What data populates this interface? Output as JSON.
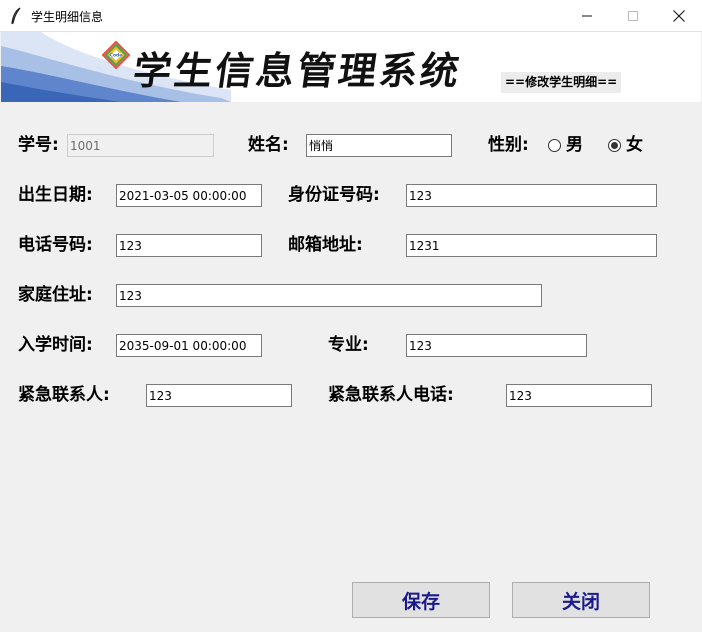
{
  "window": {
    "title": "学生明细信息"
  },
  "banner": {
    "system_title": "学生信息管理系统",
    "mode_label": "==修改学生明细=="
  },
  "form": {
    "student_id": {
      "label": "学号:",
      "value": "1001"
    },
    "name": {
      "label": "姓名:",
      "value": "悄悄"
    },
    "gender": {
      "label": "性别:",
      "options": [
        "男",
        "女"
      ],
      "selected": "女"
    },
    "birth_date": {
      "label": "出生日期:",
      "value": "2021-03-05 00:00:00"
    },
    "id_card": {
      "label": "身份证号码:",
      "value": "123"
    },
    "phone": {
      "label": "电话号码:",
      "value": "123"
    },
    "email": {
      "label": "邮箱地址:",
      "value": "1231"
    },
    "address": {
      "label": "家庭住址:",
      "value": "123"
    },
    "enroll_date": {
      "label": "入学时间:",
      "value": "2035-09-01 00:00:00"
    },
    "major": {
      "label": "专业:",
      "value": "123"
    },
    "emergency_contact": {
      "label": "紧急联系人:",
      "value": "123"
    },
    "emergency_phone": {
      "label": "紧急联系人电话:",
      "value": "123"
    }
  },
  "buttons": {
    "save": "保存",
    "close": "关闭"
  },
  "colors": {
    "button_text": "#1a1a8c",
    "window_bg": "#f0f0f0",
    "banner_wave": "#3a66b8"
  }
}
